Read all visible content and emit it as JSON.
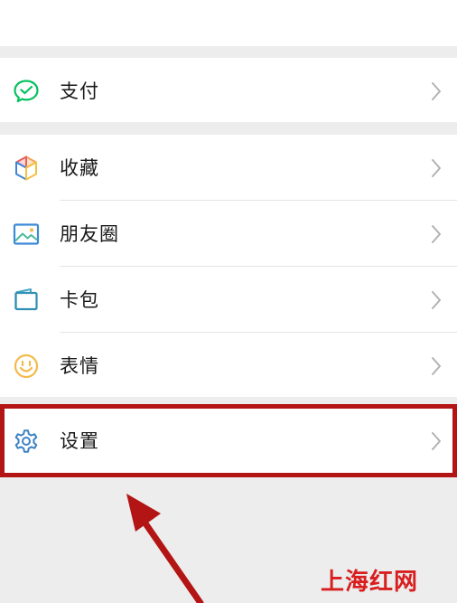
{
  "groups": [
    {
      "items": [
        {
          "label": "支付",
          "icon": "wechat-pay-icon"
        }
      ]
    },
    {
      "items": [
        {
          "label": "收藏",
          "icon": "favorites-cube-icon"
        },
        {
          "label": "朋友圈",
          "icon": "moments-image-icon"
        },
        {
          "label": "卡包",
          "icon": "card-wallet-icon"
        },
        {
          "label": "表情",
          "icon": "smiley-icon"
        }
      ]
    },
    {
      "items": [
        {
          "label": "设置",
          "icon": "gear-icon"
        }
      ]
    }
  ],
  "watermark": "上海红网",
  "colors": {
    "background": "#ededed",
    "card": "#ffffff",
    "text": "#191919",
    "chevron": "#b2b2b2",
    "pay_green": "#07c160",
    "highlight_red": "#b31414",
    "arrow_red": "#b31414",
    "watermark_red": "#d81e1e"
  }
}
